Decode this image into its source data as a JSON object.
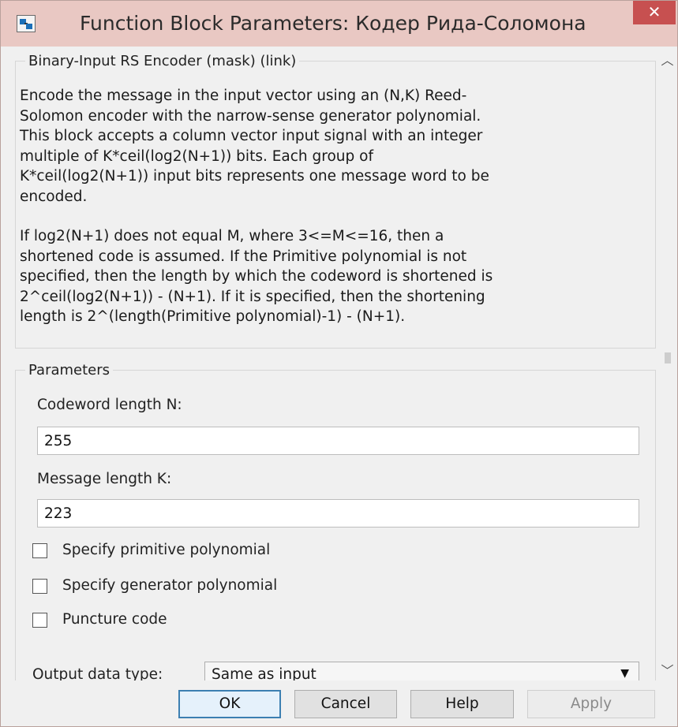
{
  "window": {
    "title": "Function Block Parameters: Кодер Рида-Соломона",
    "close_glyph": "✕"
  },
  "description": {
    "legend": "Binary-Input RS Encoder (mask) (link)",
    "paragraph1": "Encode the message in the input vector using an (N,K) Reed-\nSolomon encoder with the narrow-sense generator polynomial.\nThis block accepts a column vector input signal with an integer\nmultiple of K*ceil(log2(N+1)) bits.  Each group of\nK*ceil(log2(N+1)) input bits represents one message word to be\nencoded.",
    "paragraph2": "If log2(N+1) does not equal M, where 3<=M<=16, then a\nshortened code is assumed.  If the Primitive polynomial is not\nspecified, then the length by which the codeword is shortened is\n2^ceil(log2(N+1)) - (N+1).  If it is specified, then the shortening\nlength is 2^(length(Primitive polynomial)-1) - (N+1)."
  },
  "parameters": {
    "legend": "Parameters",
    "codeword_label": "Codeword length N:",
    "codeword_value": "255",
    "message_label": "Message length K:",
    "message_value": "223",
    "checkboxes": [
      {
        "label": "Specify primitive polynomial",
        "checked": false
      },
      {
        "label": "Specify generator polynomial",
        "checked": false
      },
      {
        "label": "Puncture code",
        "checked": false
      }
    ],
    "output_label": "Output data type:",
    "output_value": "Same as input"
  },
  "buttons": {
    "ok": "OK",
    "cancel": "Cancel",
    "help": "Help",
    "apply": "Apply"
  },
  "colors": {
    "titlebar": "#e9c8c3",
    "close": "#c75050",
    "default_button_border": "#3c7fb1"
  }
}
